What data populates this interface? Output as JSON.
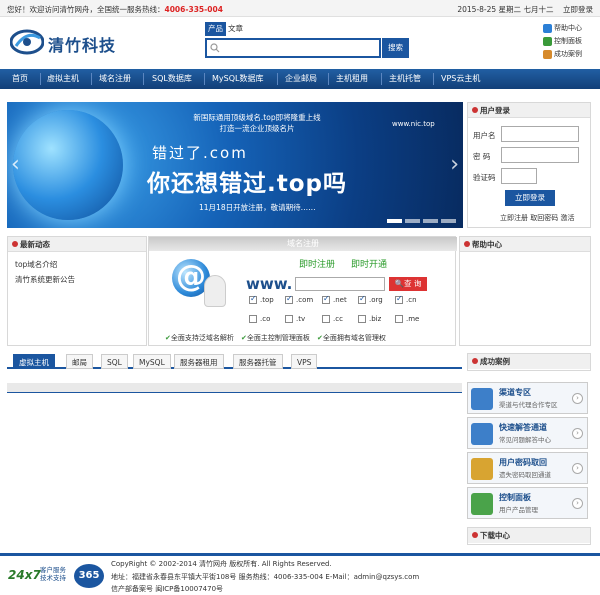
{
  "topbar": {
    "welcome": "您好！欢迎访问清竹网舟，全国统一服务热线：",
    "hotline": "4006-335-004",
    "date": "2015-8-25 星期二 七月十二",
    "login_link": "立即登录"
  },
  "logo": {
    "name": "清竹科技"
  },
  "search": {
    "tabs": [
      "产品",
      "文章"
    ],
    "button": "搜索"
  },
  "quick_links": [
    {
      "label": "帮助中心",
      "icon": "help-icon",
      "color": "#2b7fd6"
    },
    {
      "label": "控制面板",
      "icon": "control-panel-icon",
      "color": "#3a9a3a"
    },
    {
      "label": "成功案例",
      "icon": "case-icon",
      "color": "#d68a2b"
    }
  ],
  "nav": [
    "首页",
    "虚拟主机",
    "域名注册",
    "SQL数据库",
    "MySQL数据库",
    "企业邮局",
    "主机租用",
    "主机托管",
    "VPS云主机"
  ],
  "banner": {
    "line1": "新国际通用顶级域名.top即将隆重上线",
    "line2": "打造一流企业顶级名片",
    "brand": "www.nic.top",
    "headline1": "错过了.com",
    "headline2": "你还想错过.top吗",
    "footnote": "11月18日开放注册，敬请期待……"
  },
  "login": {
    "title": "用户登录",
    "username_label": "用户名",
    "password_label": "密 码",
    "captcha_label": "验证码",
    "button": "立即登录",
    "links": "立即注册 取回密码 激活"
  },
  "news": {
    "title": "最新动态",
    "items": [
      "top域名介绍",
      "清竹系统更新公告"
    ]
  },
  "domain": {
    "title": "域名注册",
    "register": "即时注册",
    "activate": "即时开通",
    "www": "www.",
    "query_button": "查 询",
    "tlds": [
      {
        "label": ".top",
        "checked": true
      },
      {
        "label": ".com",
        "checked": true
      },
      {
        "label": ".net",
        "checked": true
      },
      {
        "label": ".org",
        "checked": true
      },
      {
        "label": ".cn",
        "checked": true
      },
      {
        "label": ".co",
        "checked": false
      },
      {
        "label": ".tv",
        "checked": false
      },
      {
        "label": ".cc",
        "checked": false
      },
      {
        "label": ".biz",
        "checked": false
      },
      {
        "label": ".me",
        "checked": false
      }
    ],
    "features": [
      "全面支持泛域名解析",
      "全面主控制管理面板",
      "全面拥有域名管理权"
    ]
  },
  "help_center": {
    "title": "帮助中心"
  },
  "product_tabs": [
    "虚拟主机",
    "邮局",
    "SQL",
    "MySQL",
    "服务器租用",
    "服务器托管",
    "VPS"
  ],
  "success_cases": {
    "title": "成功案例"
  },
  "services": [
    {
      "title": "渠道专区",
      "subtitle": "渠道与代理合作专区",
      "color": "#3d7fc9"
    },
    {
      "title": "快速解答通道",
      "subtitle": "常见问题解答中心",
      "color": "#3d7fc9"
    },
    {
      "title": "用户密码取回",
      "subtitle": "遗失密码取回通道",
      "color": "#d8a431"
    },
    {
      "title": "控制面板",
      "subtitle": "用户产品管理",
      "color": "#4aa34a"
    }
  ],
  "download": {
    "title": "下载中心"
  },
  "footer": {
    "badge1": "24x7",
    "badge2": "客户服务 技术支持",
    "badge3": "365",
    "copyright": "CopyRight © 2002-2014 清竹网舟 版权所有. All Rights Reserved.",
    "address": "地址：福建省永春县东平镇大平街108号 服务热线：4006-335-004 E-Mail：admin@qzsys.com",
    "icp": "信产部备案号  闽ICP备10007470号"
  }
}
